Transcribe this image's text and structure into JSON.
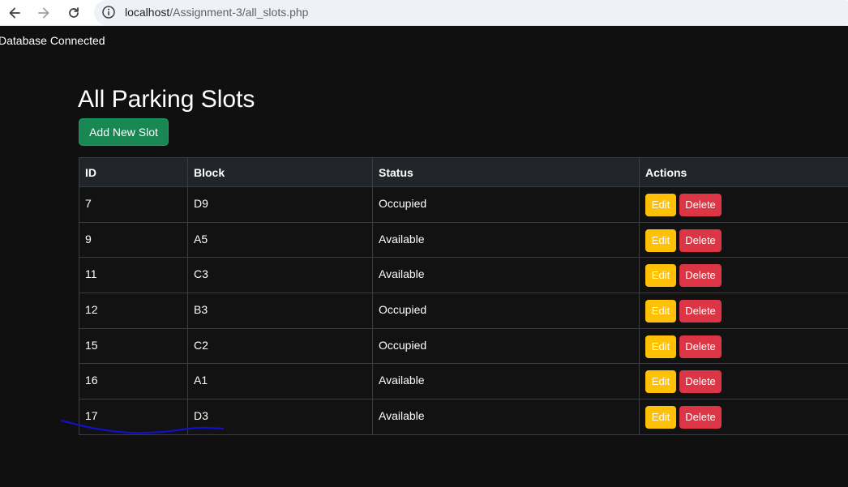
{
  "browser": {
    "url_host": "localhost",
    "url_path": "/Assignment-3/all_slots.php",
    "icons": [
      "back-arrow-icon",
      "forward-arrow-icon",
      "reload-icon",
      "site-info-icon"
    ]
  },
  "page": {
    "db_status": "Database Connected",
    "title": "All Parking Slots",
    "add_button": "Add New Slot",
    "table": {
      "headers": [
        "ID",
        "Block",
        "Status",
        "Actions"
      ],
      "rows": [
        {
          "id": "7",
          "block": "D9",
          "status": "Occupied",
          "edit": "Edit",
          "delete": "Delete"
        },
        {
          "id": "9",
          "block": "A5",
          "status": "Available",
          "edit": "Edit",
          "delete": "Delete"
        },
        {
          "id": "11",
          "block": "C3",
          "status": "Available",
          "edit": "Edit",
          "delete": "Delete"
        },
        {
          "id": "12",
          "block": "B3",
          "status": "Occupied",
          "edit": "Edit",
          "delete": "Delete"
        },
        {
          "id": "15",
          "block": "C2",
          "status": "Occupied",
          "edit": "Edit",
          "delete": "Delete"
        },
        {
          "id": "16",
          "block": "A1",
          "status": "Available",
          "edit": "Edit",
          "delete": "Delete"
        },
        {
          "id": "17",
          "block": "D3",
          "status": "Available",
          "edit": "Edit",
          "delete": "Delete"
        }
      ]
    }
  },
  "colors": {
    "background": "#101010",
    "header_row": "#212529",
    "add_button": "#198754",
    "edit_button": "#ffc107",
    "delete_button": "#dc3545",
    "annotation_stroke": "#1010d8"
  }
}
